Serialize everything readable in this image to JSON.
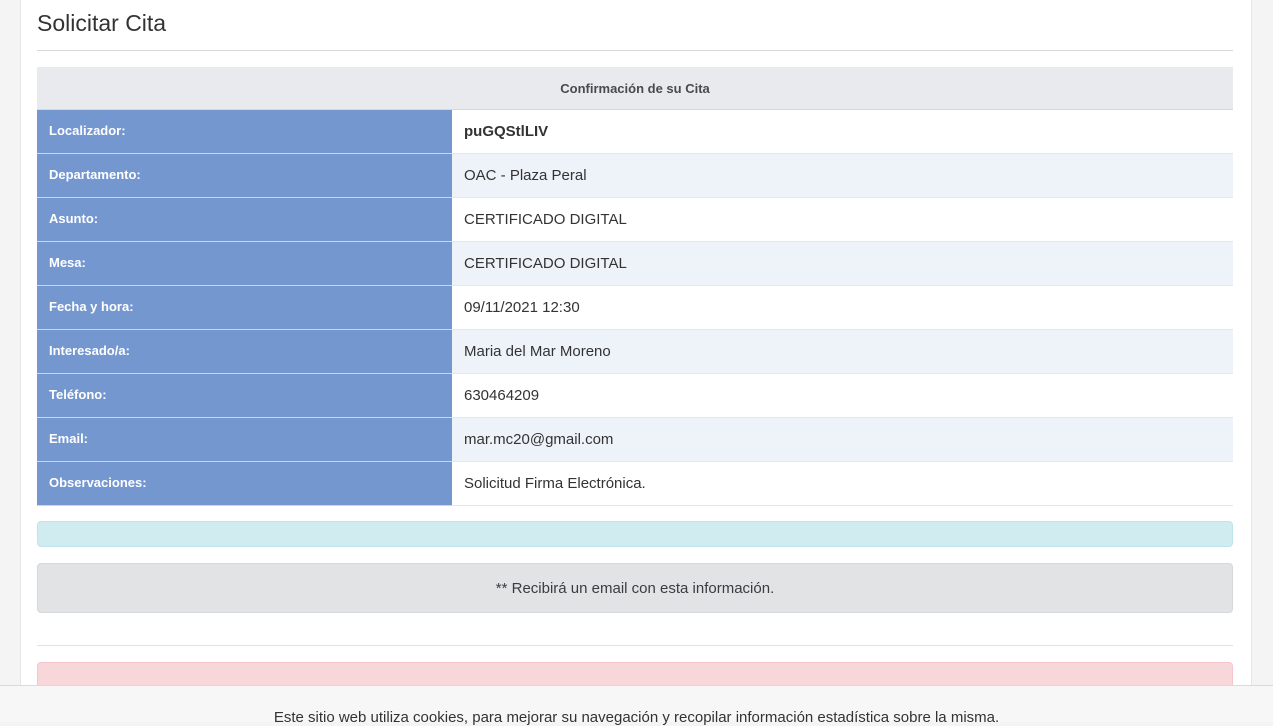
{
  "page": {
    "title": "Solicitar Cita"
  },
  "confirmation": {
    "heading": "Confirmación de su Cita",
    "rows": [
      {
        "label": "Localizador:",
        "value": "puGQStlLIV"
      },
      {
        "label": "Departamento:",
        "value": "OAC - Plaza Peral"
      },
      {
        "label": "Asunto:",
        "value": "CERTIFICADO DIGITAL"
      },
      {
        "label": "Mesa:",
        "value": "CERTIFICADO DIGITAL"
      },
      {
        "label": "Fecha y hora:",
        "value": "09/11/2021 12:30"
      },
      {
        "label": "Interesado/a:",
        "value": "Maria del Mar Moreno"
      },
      {
        "label": "Teléfono:",
        "value": "630464209"
      },
      {
        "label": "Email:",
        "value": "mar.mc20@gmail.com"
      },
      {
        "label": "Observaciones:",
        "value": "Solicitud Firma Electrónica."
      }
    ]
  },
  "notice": {
    "text": "** Recibirá un email con esta información."
  },
  "cookie_bar": {
    "text": "Este sitio web utiliza cookies, para mejorar su navegación y recopilar información estadística sobre la misma."
  },
  "colors": {
    "label_bg": "#7597d0",
    "striped_bg": "#eef2f9",
    "info_bg": "#d1ecf1",
    "notice_bg": "#e2e3e5",
    "danger_bg": "#f8d7da"
  }
}
